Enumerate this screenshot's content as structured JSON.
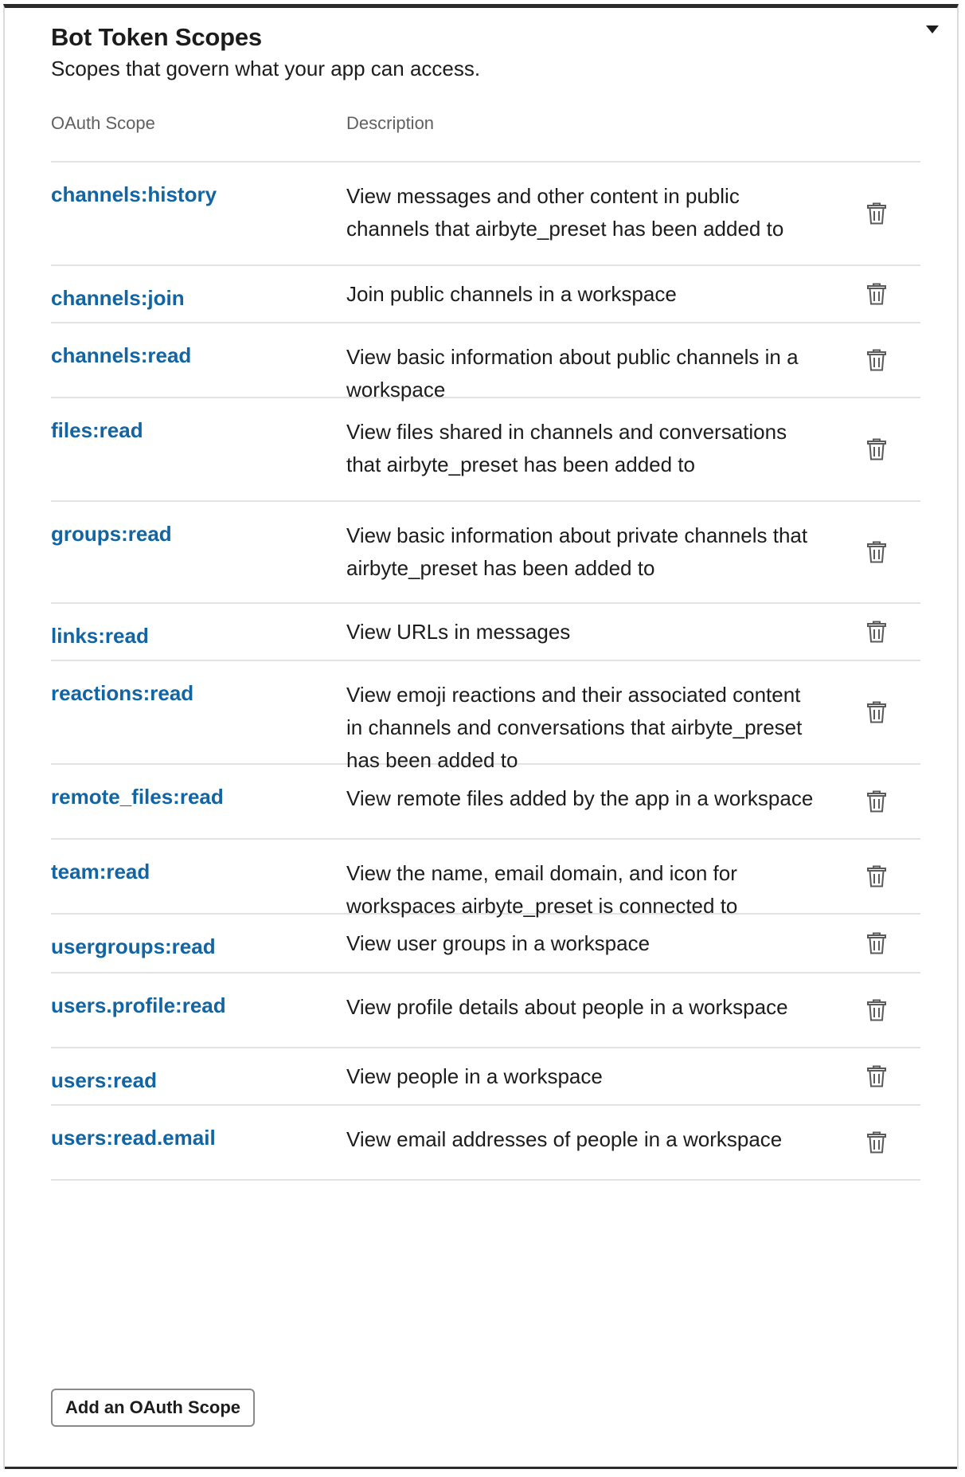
{
  "section": {
    "title": "Bot Token Scopes",
    "subtitle": "Scopes that govern what your app can access."
  },
  "table": {
    "headers": {
      "scope": "OAuth Scope",
      "description": "Description"
    },
    "rows": [
      {
        "scope": "channels:history",
        "description": "View messages and other content in public channels that airbyte_preset has been added to"
      },
      {
        "scope": "channels:join",
        "description": "Join public channels in a workspace"
      },
      {
        "scope": "channels:read",
        "description": "View basic information about public channels in a workspace"
      },
      {
        "scope": "files:read",
        "description": "View files shared in channels and conversations that airbyte_preset has been added to"
      },
      {
        "scope": "groups:read",
        "description": "View basic information about private channels that airbyte_preset has been added to"
      },
      {
        "scope": "links:read",
        "description": "View URLs in messages"
      },
      {
        "scope": "reactions:read",
        "description": "View emoji reactions and their associated content in channels and conversations that airbyte_preset has been added to"
      },
      {
        "scope": "remote_files:read",
        "description": "View remote files added by the app in a workspace"
      },
      {
        "scope": "team:read",
        "description": "View the name, email domain, and icon for workspaces airbyte_preset is connected to"
      },
      {
        "scope": "usergroups:read",
        "description": "View user groups in a workspace"
      },
      {
        "scope": "users.profile:read",
        "description": "View profile details about people in a workspace"
      },
      {
        "scope": "users:read",
        "description": "View people in a workspace"
      },
      {
        "scope": "users:read.email",
        "description": "View email addresses of people in a workspace"
      }
    ]
  },
  "actions": {
    "add_scope_label": "Add an OAuth Scope"
  },
  "icons": {
    "collapse": "caret-down-icon",
    "delete": "trash-icon"
  },
  "colors": {
    "link": "#1264a3",
    "text": "#1d1c1d",
    "muted": "#616061",
    "divider": "#e2e2e2"
  }
}
